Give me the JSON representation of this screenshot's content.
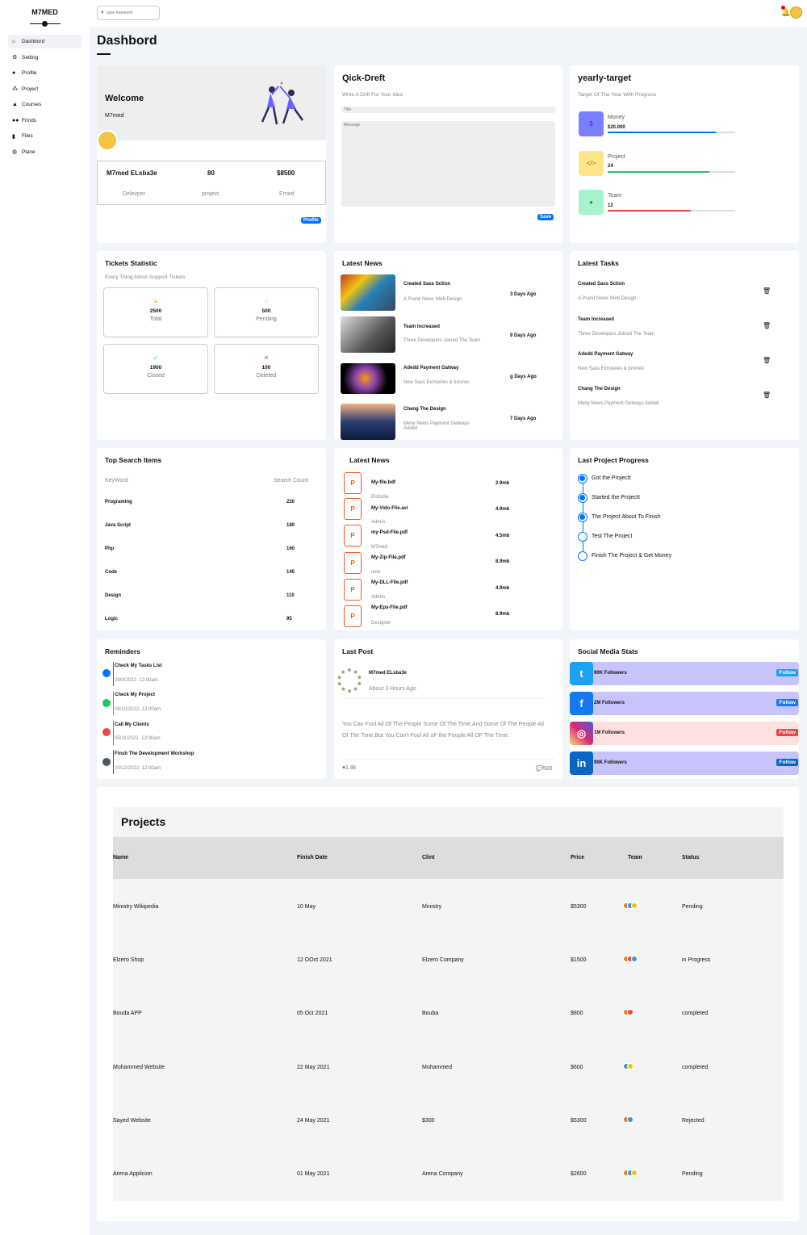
{
  "app": {
    "logo": "M7MED",
    "page_title": "Dashbord"
  },
  "sidebar": {
    "items": [
      {
        "label": "Dashbord",
        "icon": "home-icon"
      },
      {
        "label": "Setting",
        "icon": "gear-icon"
      },
      {
        "label": "Profile",
        "icon": "user-icon"
      },
      {
        "label": "Project",
        "icon": "diagram-icon"
      },
      {
        "label": "Courses",
        "icon": "graduation-cap-icon"
      },
      {
        "label": "Frinds",
        "icon": "users-icon"
      },
      {
        "label": "Files",
        "icon": "file-icon"
      },
      {
        "label": "Plane",
        "icon": "globe-icon"
      }
    ]
  },
  "search": {
    "placeholder": "type keyword"
  },
  "welcome": {
    "title": "Welcome",
    "name": "M7med",
    "full_name": "M7med ELsba3e",
    "role": "Delevper",
    "projects": "80",
    "projects_label": "project",
    "earned": "$8500",
    "earned_label": "Erned",
    "button": "Profile"
  },
  "draft": {
    "title": "Qick-Dreft",
    "subtitle": "Write A Drift For Your Idea",
    "title_placeholder": "Title",
    "message_placeholder": "Message",
    "button": "Save"
  },
  "target": {
    "title": "yearly-target",
    "subtitle": "Target Of The Year With Progress",
    "items": [
      {
        "label": "Money",
        "value": "$20.000",
        "progress": 0.85,
        "color": "#0075ff",
        "bg": "#7b7efc",
        "icon": "$"
      },
      {
        "label": "Project",
        "value": "24",
        "progress": 0.8,
        "color": "#22c55e",
        "bg": "#fde68a",
        "icon": "</>"
      },
      {
        "label": "Team",
        "value": "12",
        "progress": 0.65,
        "color": "#ef4444",
        "bg": "#a7f3d0",
        "icon": "👤"
      }
    ]
  },
  "tickets": {
    "title": "Tickets Statistic",
    "subtitle": "Every Thing About Support Tickets",
    "items": [
      {
        "value": "2500",
        "label": "Total",
        "icon": "≡",
        "color": "#f59e0b"
      },
      {
        "value": "500",
        "label": "Pending",
        "icon": "◌",
        "color": "#0075ff"
      },
      {
        "value": "1900",
        "label": "Closed",
        "icon": "✓",
        "color": "#22c55e"
      },
      {
        "value": "100",
        "label": "Deleted",
        "icon": "✕",
        "color": "#ef4444"
      }
    ]
  },
  "news": {
    "title": "Latest News",
    "items": [
      {
        "title": "Created Sass Sction",
        "desc": "A Prand News Web Design",
        "time": "3 Days Ago"
      },
      {
        "title": "Team Increased",
        "desc": "Three Developers Joined The Team",
        "time": "9 Days Ago"
      },
      {
        "title": "Adedd Payment Gatway",
        "desc": "New Sass Exmpeles & tutories",
        "time": "g Days Ago"
      },
      {
        "title": "Chang The Design",
        "desc": "Meny News Payment Getways Added",
        "time": "7 Days Ago"
      }
    ]
  },
  "tasks": {
    "title": "Latest Tasks",
    "items": [
      {
        "title": "Created Sass Sction",
        "desc": "A Prand News Web Design"
      },
      {
        "title": "Team Increased",
        "desc": "Three Developers Joined The Team"
      },
      {
        "title": "Adedd Payment Gatway",
        "desc": "New Sass Exmpeles & tutories"
      },
      {
        "title": "Chang The Design",
        "desc": "Meny News Payment Getways Added"
      }
    ]
  },
  "search_items": {
    "title": "Top Search Items",
    "col_keyword": "KeyWord",
    "col_count": "Search Count",
    "items": [
      {
        "keyword": "Programing",
        "count": "220"
      },
      {
        "keyword": "Java Script",
        "count": "180"
      },
      {
        "keyword": "Php",
        "count": "160"
      },
      {
        "keyword": "Code",
        "count": "145"
      },
      {
        "keyword": "Design",
        "count": "110"
      },
      {
        "keyword": "Logic",
        "count": "95"
      }
    ]
  },
  "files": {
    "title": "Latest News",
    "icon_letter": "P",
    "items": [
      {
        "name": "My-file.bdf",
        "owner": "Elsba3e",
        "size": "2.9mb"
      },
      {
        "name": "My-Vido-File.avi",
        "owner": "Admin",
        "size": "4.9mb"
      },
      {
        "name": "my-Psd-File.pdf",
        "owner": "M7med",
        "size": "4.5mb"
      },
      {
        "name": "My-Zip-File.pdf",
        "owner": "user",
        "size": "8.9mb"
      },
      {
        "name": "My-DLL-File.pdf",
        "owner": "Admin",
        "size": "4.9mb"
      },
      {
        "name": "My-Eps-File.pdf",
        "owner": "Designer",
        "size": "8.9mb"
      }
    ]
  },
  "progress": {
    "title": "Last Project Progress",
    "items": [
      {
        "label": "Got the Projectt",
        "done": true
      },
      {
        "label": "Started the Projectt",
        "done": true
      },
      {
        "label": "The Project About To Finish",
        "done": true
      },
      {
        "label": "Test The Project",
        "done": false
      },
      {
        "label": "Finish The Project & Get Money",
        "done": false
      }
    ]
  },
  "reminders": {
    "title": "Reminders",
    "items": [
      {
        "title": "Check My Tasks List",
        "date": "28/0/2022- 12:00am",
        "color": "#0075ff"
      },
      {
        "title": "Check My Project",
        "date": "26/10/2022- 12:00am",
        "color": "#22c55e"
      },
      {
        "title": "Call My Clients",
        "date": "05/11/2022- 12:00am",
        "color": "#ef4444"
      },
      {
        "title": "Finsh The Development Workshop",
        "date": "20/12/2022- 12:00am",
        "color": "#4b5563"
      }
    ]
  },
  "post": {
    "title": "Last Post",
    "author": "M7med ELsba3e",
    "time": "About 3 Hours Ago",
    "text": "You Can Fool All Of The People Some Of The Time,And Some Of The People All Of The Time,But You Can't Fool All oF the People All OF The Time.",
    "likes": "1.8k",
    "comments": "500"
  },
  "social": {
    "title": "Social Media Stats",
    "follow_label": "Follow",
    "items": [
      {
        "network": "twitter",
        "icon": "twitter-icon",
        "glyph": "t",
        "followers": "90K Followers",
        "color": "#1da1f2",
        "bg": "#c7c3fb",
        "btn": "#1da1f2"
      },
      {
        "network": "facebook",
        "icon": "facebook-icon",
        "glyph": "f",
        "followers": "2M Followers",
        "color": "#1877f2",
        "bg": "#c7c3fb",
        "btn": "#1877f2"
      },
      {
        "network": "instagram",
        "icon": "instagram-icon",
        "glyph": "◎",
        "followers": "1M Followers",
        "color": "#d62976",
        "bg": "#fde1e1",
        "btn": "#ef4444"
      },
      {
        "network": "linkedin",
        "icon": "linkedin-icon",
        "glyph": "in",
        "followers": "90K Followers",
        "color": "#0a66c2",
        "bg": "#c7c3fb",
        "btn": "#0a66c2"
      }
    ]
  },
  "projects": {
    "title": "Projects",
    "headers": [
      "Name",
      "Finish Date",
      "Clint",
      "Price",
      "Team",
      "Status"
    ],
    "rows": [
      {
        "name": "Ministry Wikipedia",
        "date": "10 May",
        "client": "Ministry",
        "price": "$5300",
        "team": 3,
        "status": "Pending"
      },
      {
        "name": "Elzero Shop",
        "date": "12 OOct 2021",
        "client": "Elzero Company",
        "price": "$1500",
        "team": 3,
        "status": "in Progress"
      },
      {
        "name": "Bouda APP",
        "date": "05 Oct 2021",
        "client": "Bouba",
        "price": "$800",
        "team": 2,
        "status": "completed"
      },
      {
        "name": "Mohammed Website",
        "date": "22 May 2021",
        "client": "Mohammed",
        "price": "$600",
        "team": 2,
        "status": "completed"
      },
      {
        "name": "Sayed Website",
        "date": "24 May 2021",
        "client": "$300",
        "price": "$5300",
        "team": 2,
        "status": "Rejected"
      },
      {
        "name": "Arena Applicion",
        "date": "01 May 2021",
        "client": "Arena Company",
        "price": "$2600",
        "team": 3,
        "status": "Pending"
      }
    ]
  }
}
